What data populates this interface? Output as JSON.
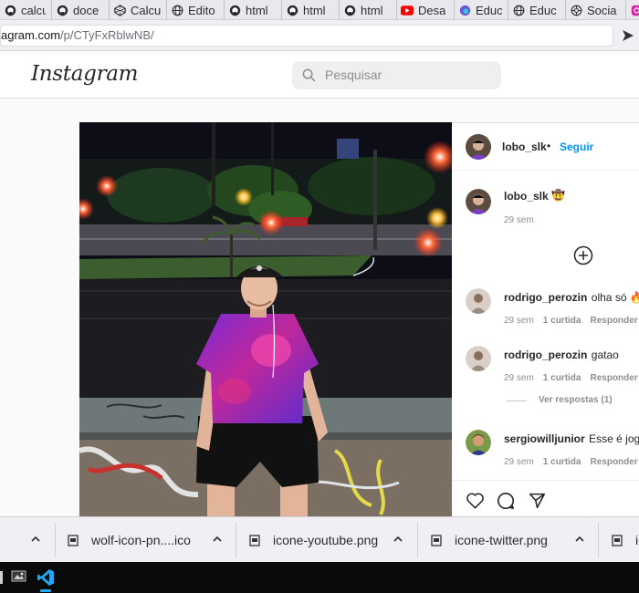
{
  "browser": {
    "tabs": [
      {
        "label": "calcu",
        "icon": "github-icon"
      },
      {
        "label": "doce",
        "icon": "github-icon"
      },
      {
        "label": "Calcu",
        "icon": "codepen-icon"
      },
      {
        "label": "Edito",
        "icon": "globe-icon"
      },
      {
        "label": "html",
        "icon": "github-icon"
      },
      {
        "label": "html",
        "icon": "github-icon"
      },
      {
        "label": "html",
        "icon": "github-icon"
      },
      {
        "label": "Desa",
        "icon": "youtube-icon"
      },
      {
        "label": "Educ",
        "icon": "edge-icon"
      },
      {
        "label": "Educ",
        "icon": "globe-icon"
      },
      {
        "label": "Socia",
        "icon": "openai-icon"
      }
    ],
    "url_domain": "agram.com",
    "url_path": "/p/CTyFxRblwNB/"
  },
  "instagram": {
    "logo": "Instagram",
    "search_placeholder": "Pesquisar"
  },
  "post": {
    "author": "lobo_slk",
    "separator": "•",
    "follow": "Seguir",
    "caption_user": "lobo_slk",
    "caption_emoji": "🤠",
    "caption_time": "29 sem"
  },
  "comments": [
    {
      "user": "rodrigo_perozin",
      "text": "olha só 🔥",
      "time": "29 sem",
      "likes": "1 curtida",
      "reply": "Responder"
    },
    {
      "user": "rodrigo_perozin",
      "text": "gatao",
      "time": "29 sem",
      "likes": "1 curtida",
      "reply": "Responder",
      "view_replies": "Ver respostas (1)"
    },
    {
      "user": "sergiowilljunior",
      "text": "Esse é jog",
      "time": "29 sem",
      "likes": "1 curtida",
      "reply": "Responder"
    }
  ],
  "downloads": [
    {
      "name": "wolf-icon-pn....ico"
    },
    {
      "name": "icone-youtube.png"
    },
    {
      "name": "icone-twitter.png"
    },
    {
      "name": "ic"
    }
  ],
  "colors": {
    "instagram_blue": "#0095f6",
    "tab_strip": "#e9e9ed",
    "taskbar": "#0a0a0a",
    "vscode_blue": "#23a9f2"
  }
}
